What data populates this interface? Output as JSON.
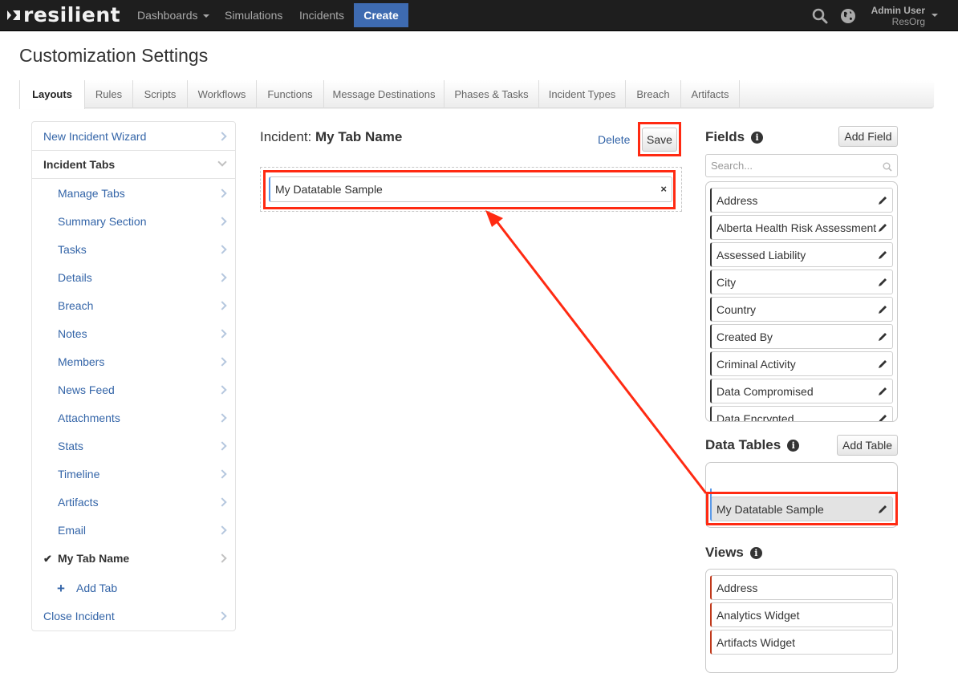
{
  "topnav": {
    "logo": "resilient",
    "items": [
      {
        "label": "Dashboards",
        "has_caret": true
      },
      {
        "label": "Simulations"
      },
      {
        "label": "Incidents"
      }
    ],
    "create_label": "Create",
    "search_icon": "search-icon",
    "globe_icon": "globe-icon",
    "user_name": "Admin User",
    "user_org": "ResOrg"
  },
  "page_title": "Customization Settings",
  "tabs": [
    {
      "label": "Layouts",
      "active": true
    },
    {
      "label": "Rules"
    },
    {
      "label": "Scripts"
    },
    {
      "label": "Workflows"
    },
    {
      "label": "Functions"
    },
    {
      "label": "Message Destinations"
    },
    {
      "label": "Phases & Tasks"
    },
    {
      "label": "Incident Types"
    },
    {
      "label": "Breach"
    },
    {
      "label": "Artifacts"
    }
  ],
  "sidebar": {
    "items": [
      {
        "label": "New Incident Wizard"
      },
      {
        "label": "Incident Tabs",
        "expanded": true
      },
      {
        "label": "Manage Tabs"
      },
      {
        "label": "Summary Section"
      },
      {
        "label": "Tasks"
      },
      {
        "label": "Details"
      },
      {
        "label": "Breach"
      },
      {
        "label": "Notes"
      },
      {
        "label": "Members"
      },
      {
        "label": "News Feed"
      },
      {
        "label": "Attachments"
      },
      {
        "label": "Stats"
      },
      {
        "label": "Timeline"
      },
      {
        "label": "Artifacts"
      },
      {
        "label": "Email"
      },
      {
        "label": "My Tab Name",
        "selected": true
      },
      {
        "label": "Add Tab"
      },
      {
        "label": "Close Incident"
      }
    ]
  },
  "editor": {
    "title_prefix": "Incident:",
    "title_name": "My Tab Name",
    "delete_label": "Delete",
    "save_label": "Save",
    "placed_items": [
      {
        "label": "My Datatable Sample",
        "remove_icon": "×"
      }
    ]
  },
  "fields": {
    "title": "Fields",
    "add_label": "Add Field",
    "search_placeholder": "Search...",
    "items": [
      "Address",
      "Alberta Health Risk Assessment",
      "Assessed Liability",
      "City",
      "Country",
      "Created By",
      "Criminal Activity",
      "Data Compromised",
      "Data Encrypted"
    ]
  },
  "data_tables": {
    "title": "Data Tables",
    "add_label": "Add Table",
    "items": [
      "My Datatable Sample"
    ]
  },
  "views": {
    "title": "Views",
    "items": [
      "Address",
      "Analytics Widget",
      "Artifacts Widget"
    ]
  },
  "colors": {
    "nav_bg": "#1e1e1e",
    "create_bg": "#3e6bb1",
    "link": "#3465a8",
    "annotation": "#ff2a12",
    "field_accent": "#333333",
    "view_accent": "#c0391b",
    "datatable_accent": "#5b9ae8"
  }
}
